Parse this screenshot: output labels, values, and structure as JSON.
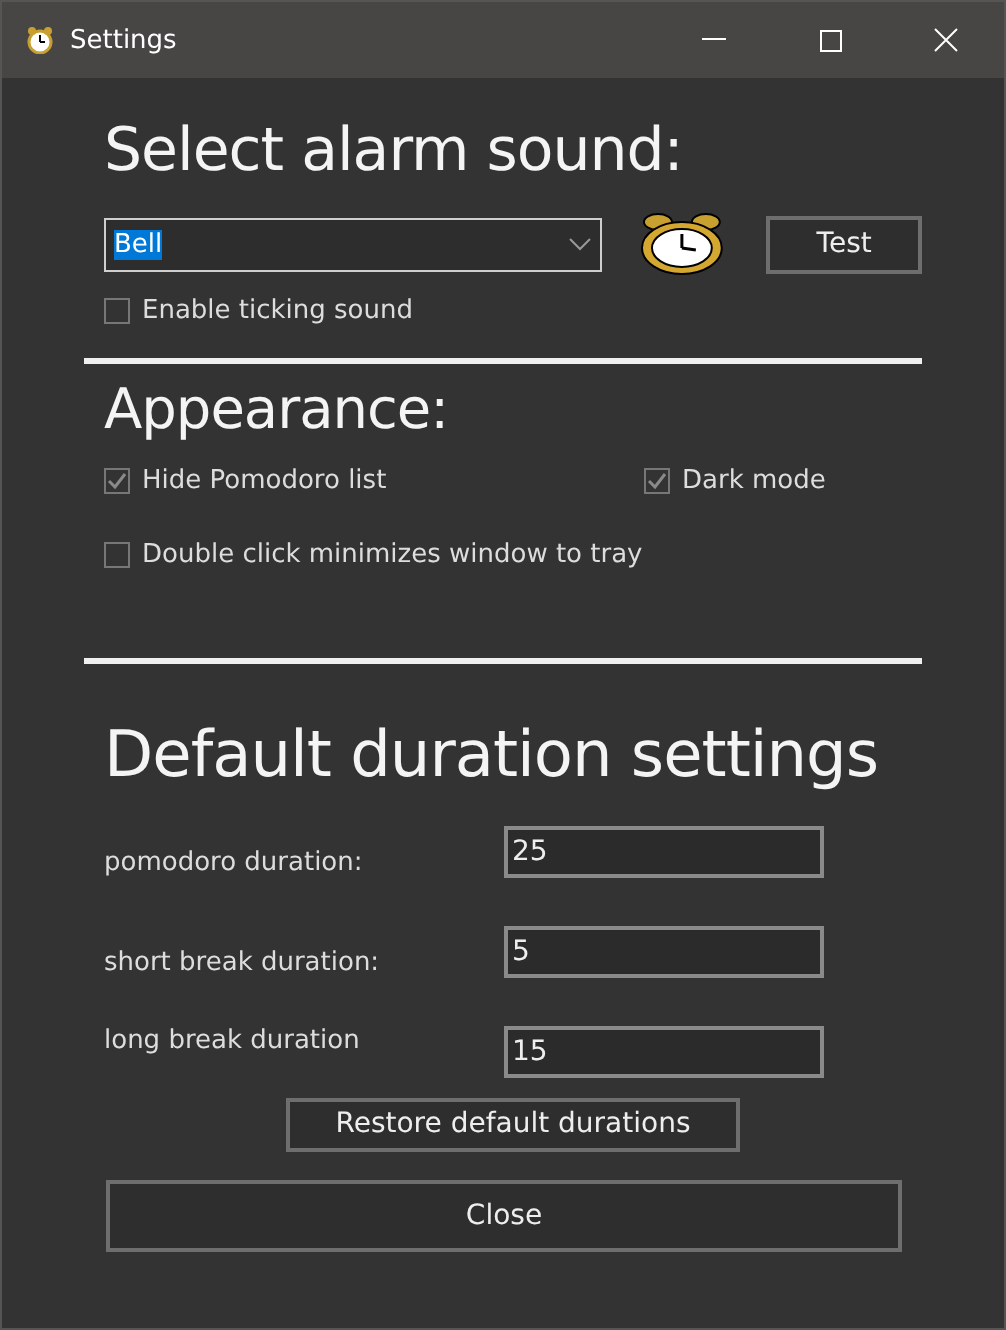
{
  "window": {
    "title": "Settings"
  },
  "alarm": {
    "heading": "Select alarm sound:",
    "sound": {
      "value": "Bell",
      "highlighted": true
    },
    "test_button": "Test",
    "ticking": {
      "label": "Enable ticking sound",
      "checked": false
    }
  },
  "appearance": {
    "heading": "Appearance:",
    "options": [
      {
        "label": "Hide Pomodoro list",
        "checked": true
      },
      {
        "label": "Dark mode",
        "checked": true
      },
      {
        "label": "Double click minimizes window to tray",
        "checked": false
      }
    ]
  },
  "durations": {
    "heading": "Default duration settings",
    "fields": [
      {
        "label": "pomodoro duration:",
        "value": "25"
      },
      {
        "label": "short break duration:",
        "value": "5"
      },
      {
        "label": "long break duration",
        "value": "15"
      }
    ],
    "restore_button": "Restore default durations"
  },
  "close_button": "Close"
}
